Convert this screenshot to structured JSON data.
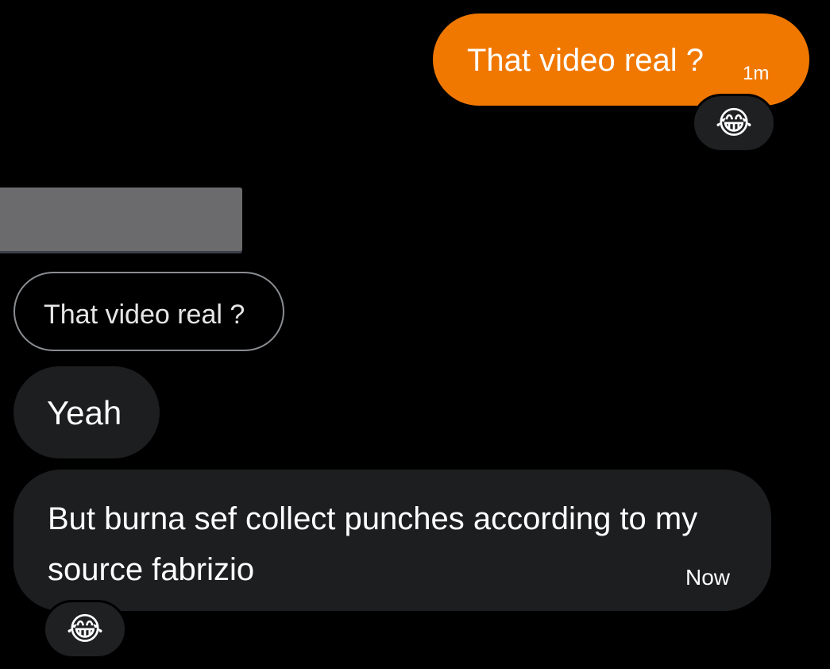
{
  "conversation": {
    "messages": [
      {
        "direction": "outgoing",
        "text": "That video real ?",
        "timestamp": "1m",
        "reaction": "😂",
        "bubble_color": "#f07800"
      },
      {
        "direction": "incoming",
        "type": "media",
        "media_color": "#6b6b6d"
      },
      {
        "direction": "incoming",
        "type": "reply-quote",
        "text": "That video real ?"
      },
      {
        "direction": "incoming",
        "text": "Yeah"
      },
      {
        "direction": "incoming",
        "text": "But burna sef collect punches according to my source fabrizio",
        "timestamp": "Now",
        "reaction": "😂",
        "bubble_color": "#1c1e20"
      }
    ]
  },
  "theme": {
    "background": "#000000",
    "accent": "#f07800",
    "incoming_bubble": "#1c1e20",
    "reaction_pill": "#1e2022"
  },
  "icons": {
    "reaction_emoji": "face-with-tears-of-joy-icon"
  }
}
